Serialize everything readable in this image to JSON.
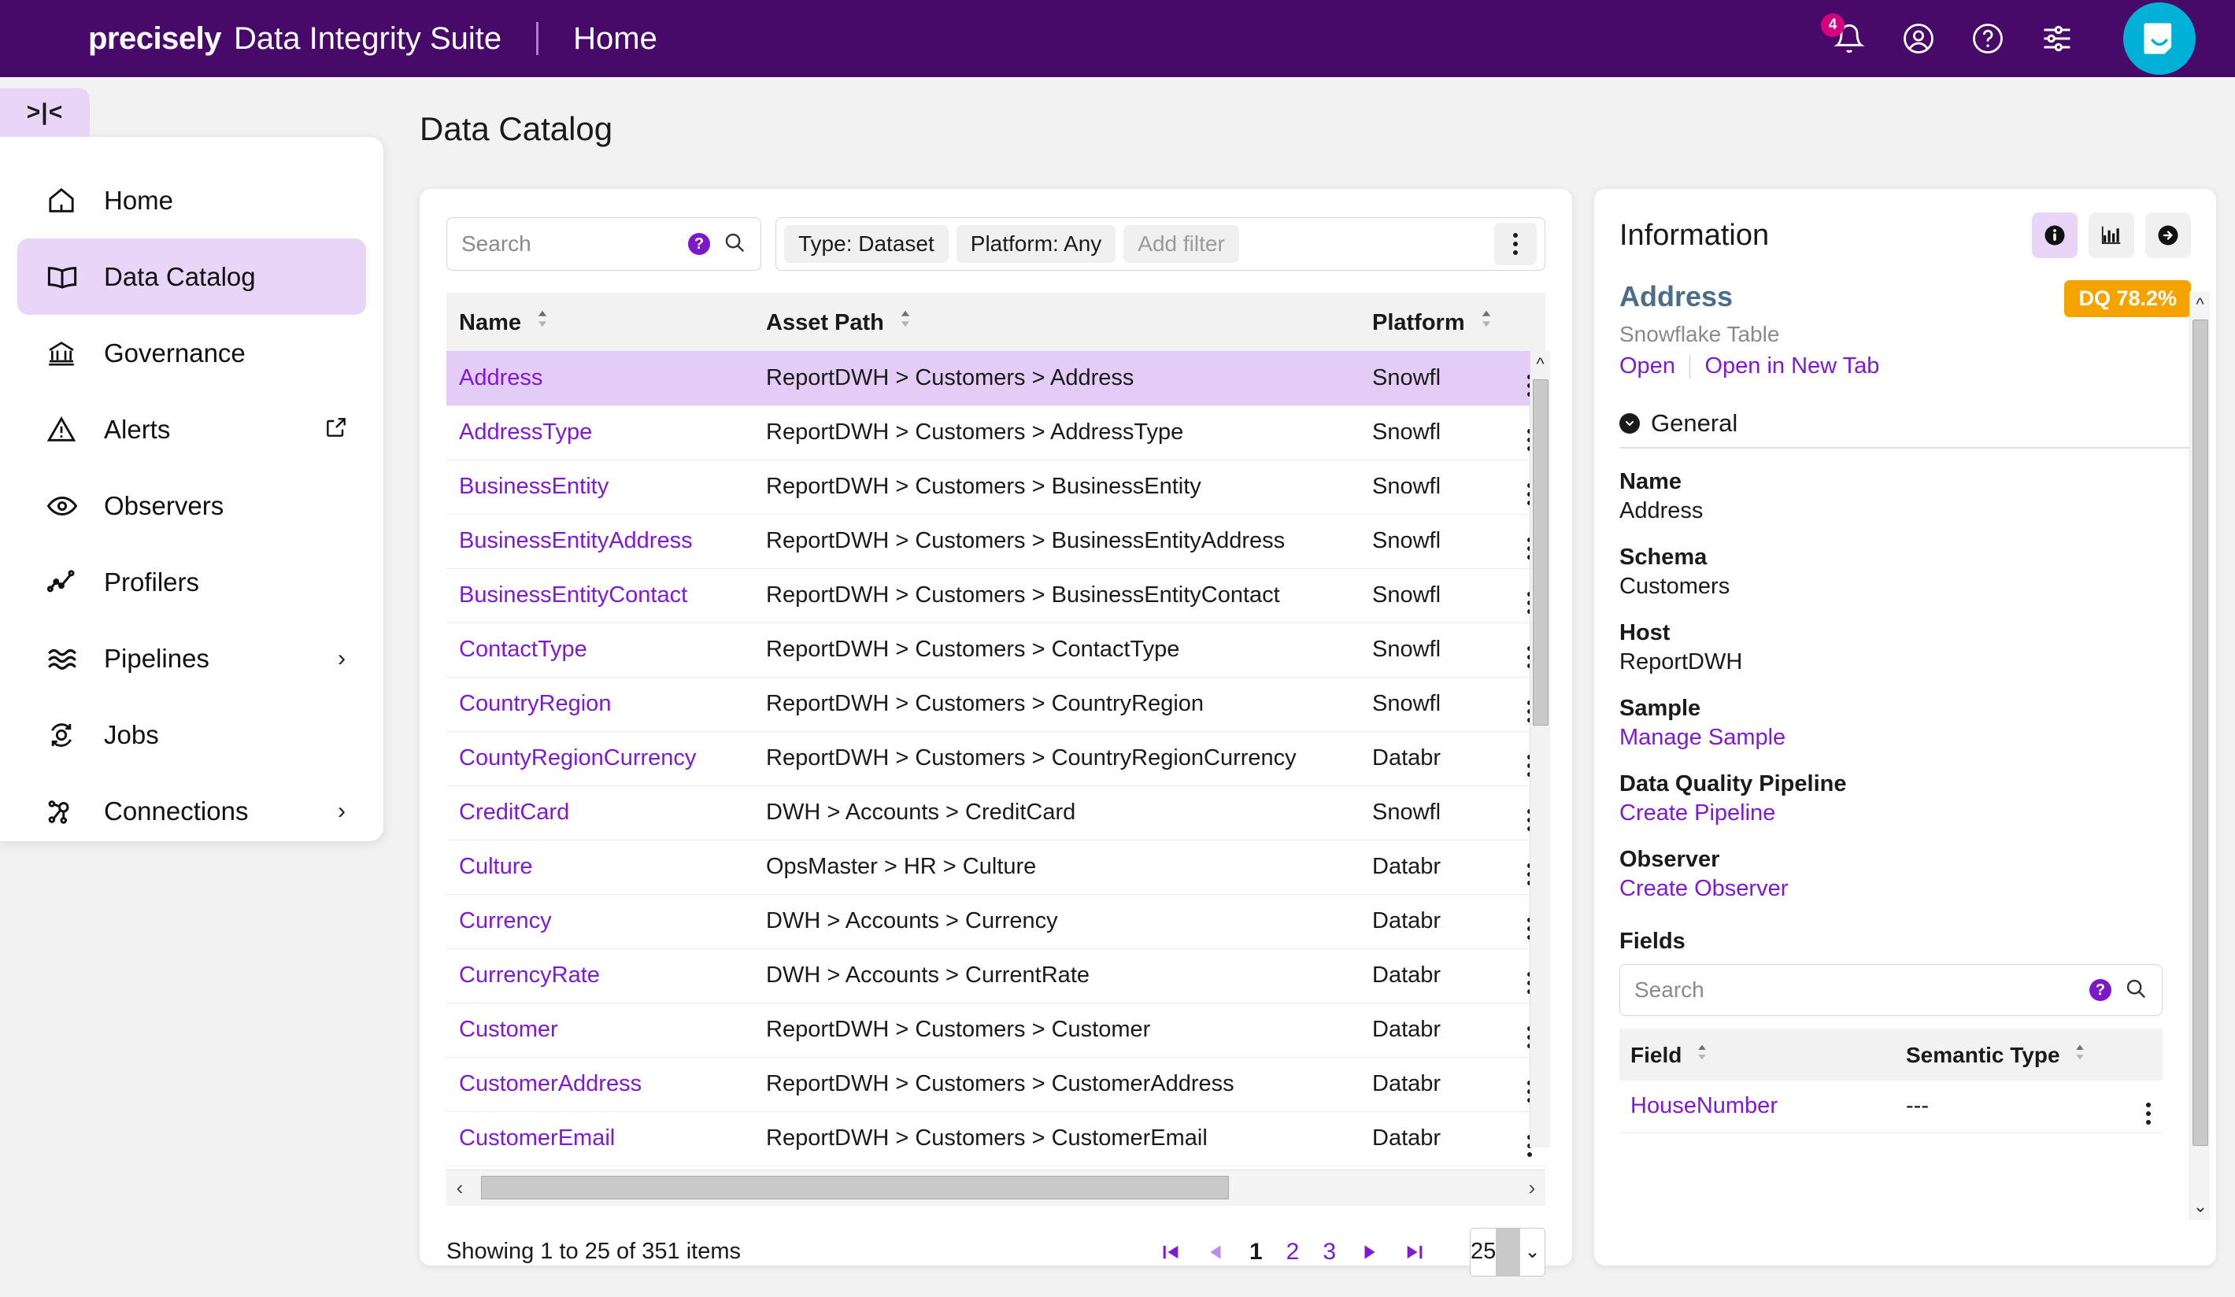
{
  "topbar": {
    "brand": "precisely",
    "suite": "Data Integrity Suite",
    "page": "Home",
    "notification_count": "4",
    "icons": [
      "bell-icon",
      "user-account-icon",
      "help-icon",
      "settings-sliders-icon",
      "chat-widget-icon"
    ]
  },
  "sidebar": {
    "collapse_glyph": ">|<",
    "items": [
      {
        "label": "Home",
        "icon": "home-icon"
      },
      {
        "label": "Data Catalog",
        "icon": "book-icon"
      },
      {
        "label": "Governance",
        "icon": "bank-icon"
      },
      {
        "label": "Alerts",
        "icon": "warning-triangle-icon"
      },
      {
        "label": "Observers",
        "icon": "eye-icon"
      },
      {
        "label": "Profilers",
        "icon": "line-chart-icon"
      },
      {
        "label": "Pipelines",
        "icon": "waves-icon"
      },
      {
        "label": "Jobs",
        "icon": "refresh-cycle-icon"
      },
      {
        "label": "Connections",
        "icon": "nodes-icon"
      }
    ]
  },
  "page": {
    "title": "Data Catalog"
  },
  "toolbar": {
    "search_placeholder": "Search",
    "chips": [
      "Type: Dataset",
      "Platform: Any"
    ],
    "add_filter": "Add filter"
  },
  "table": {
    "columns": [
      "Name",
      "Asset Path",
      "Platform"
    ],
    "rows": [
      {
        "name": "Address",
        "path": "ReportDWH > Customers > Address",
        "platform": "Snowfl"
      },
      {
        "name": "AddressType",
        "path": "ReportDWH > Customers > AddressType",
        "platform": "Snowfl"
      },
      {
        "name": "BusinessEntity",
        "path": "ReportDWH > Customers > BusinessEntity",
        "platform": "Snowfl"
      },
      {
        "name": "BusinessEntityAddress",
        "path": "ReportDWH > Customers > BusinessEntityAddress",
        "platform": "Snowfl"
      },
      {
        "name": "BusinessEntityContact",
        "path": "ReportDWH > Customers > BusinessEntityContact",
        "platform": "Snowfl"
      },
      {
        "name": "ContactType",
        "path": "ReportDWH > Customers > ContactType",
        "platform": "Snowfl"
      },
      {
        "name": "CountryRegion",
        "path": "ReportDWH > Customers > CountryRegion",
        "platform": "Snowfl"
      },
      {
        "name": "CountyRegionCurrency",
        "path": "ReportDWH > Customers > CountryRegionCurrency",
        "platform": "Databr"
      },
      {
        "name": "CreditCard",
        "path": "DWH > Accounts >  CreditCard",
        "platform": "Snowfl"
      },
      {
        "name": "Culture",
        "path": "OpsMaster > HR >  Culture",
        "platform": "Databr"
      },
      {
        "name": "Currency",
        "path": "DWH > Accounts >  Currency",
        "platform": "Databr"
      },
      {
        "name": "CurrencyRate",
        "path": "DWH > Accounts >  CurrentRate",
        "platform": "Databr"
      },
      {
        "name": "Customer",
        "path": "ReportDWH > Customers > Customer",
        "platform": "Databr"
      },
      {
        "name": "CustomerAddress",
        "path": "ReportDWH > Customers > CustomerAddress",
        "platform": "Databr"
      },
      {
        "name": "CustomerEmail",
        "path": "ReportDWH > Customers > CustomerEmail",
        "platform": "Databr"
      }
    ]
  },
  "pager": {
    "info": "Showing 1 to 25 of 351 items",
    "first": "first-page-icon",
    "prev": "prev-page-icon",
    "pages": [
      "1",
      "2",
      "3"
    ],
    "next": "next-page-icon",
    "last": "last-page-icon",
    "page_size": "25"
  },
  "info": {
    "title": "Information",
    "tabs": [
      "info-icon",
      "bar-chart-icon",
      "arrow-right-circle-icon"
    ],
    "asset_name": "Address",
    "dq_badge": "DQ 78.2%",
    "asset_type": "Snowflake Table",
    "open_label": "Open",
    "open_new_tab_label": "Open in New Tab",
    "section_general": "General",
    "fields": [
      {
        "key": "Name",
        "value": "Address",
        "is_link": false
      },
      {
        "key": "Schema",
        "value": "Customers",
        "is_link": false
      },
      {
        "key": "Host",
        "value": "ReportDWH",
        "is_link": false
      },
      {
        "key": "Sample",
        "value": "Manage Sample",
        "is_link": true
      },
      {
        "key": "Data Quality Pipeline",
        "value": "Create Pipeline",
        "is_link": true
      },
      {
        "key": "Observer",
        "value": "Create Observer",
        "is_link": true
      }
    ],
    "fields_label": "Fields",
    "fields_search_placeholder": "Search",
    "fields_columns": [
      "Field",
      "Semantic Type"
    ],
    "fields_rows": [
      {
        "field": "HouseNumber",
        "semantic_type": "---"
      }
    ]
  },
  "colors": {
    "header_purple": "#470a68",
    "accent_purple": "#8019d6",
    "selected_row": "#e3cdf7",
    "badge_pink": "#d6007f",
    "dq_orange": "#f5a300",
    "chat_cyan": "#00b0d7"
  }
}
